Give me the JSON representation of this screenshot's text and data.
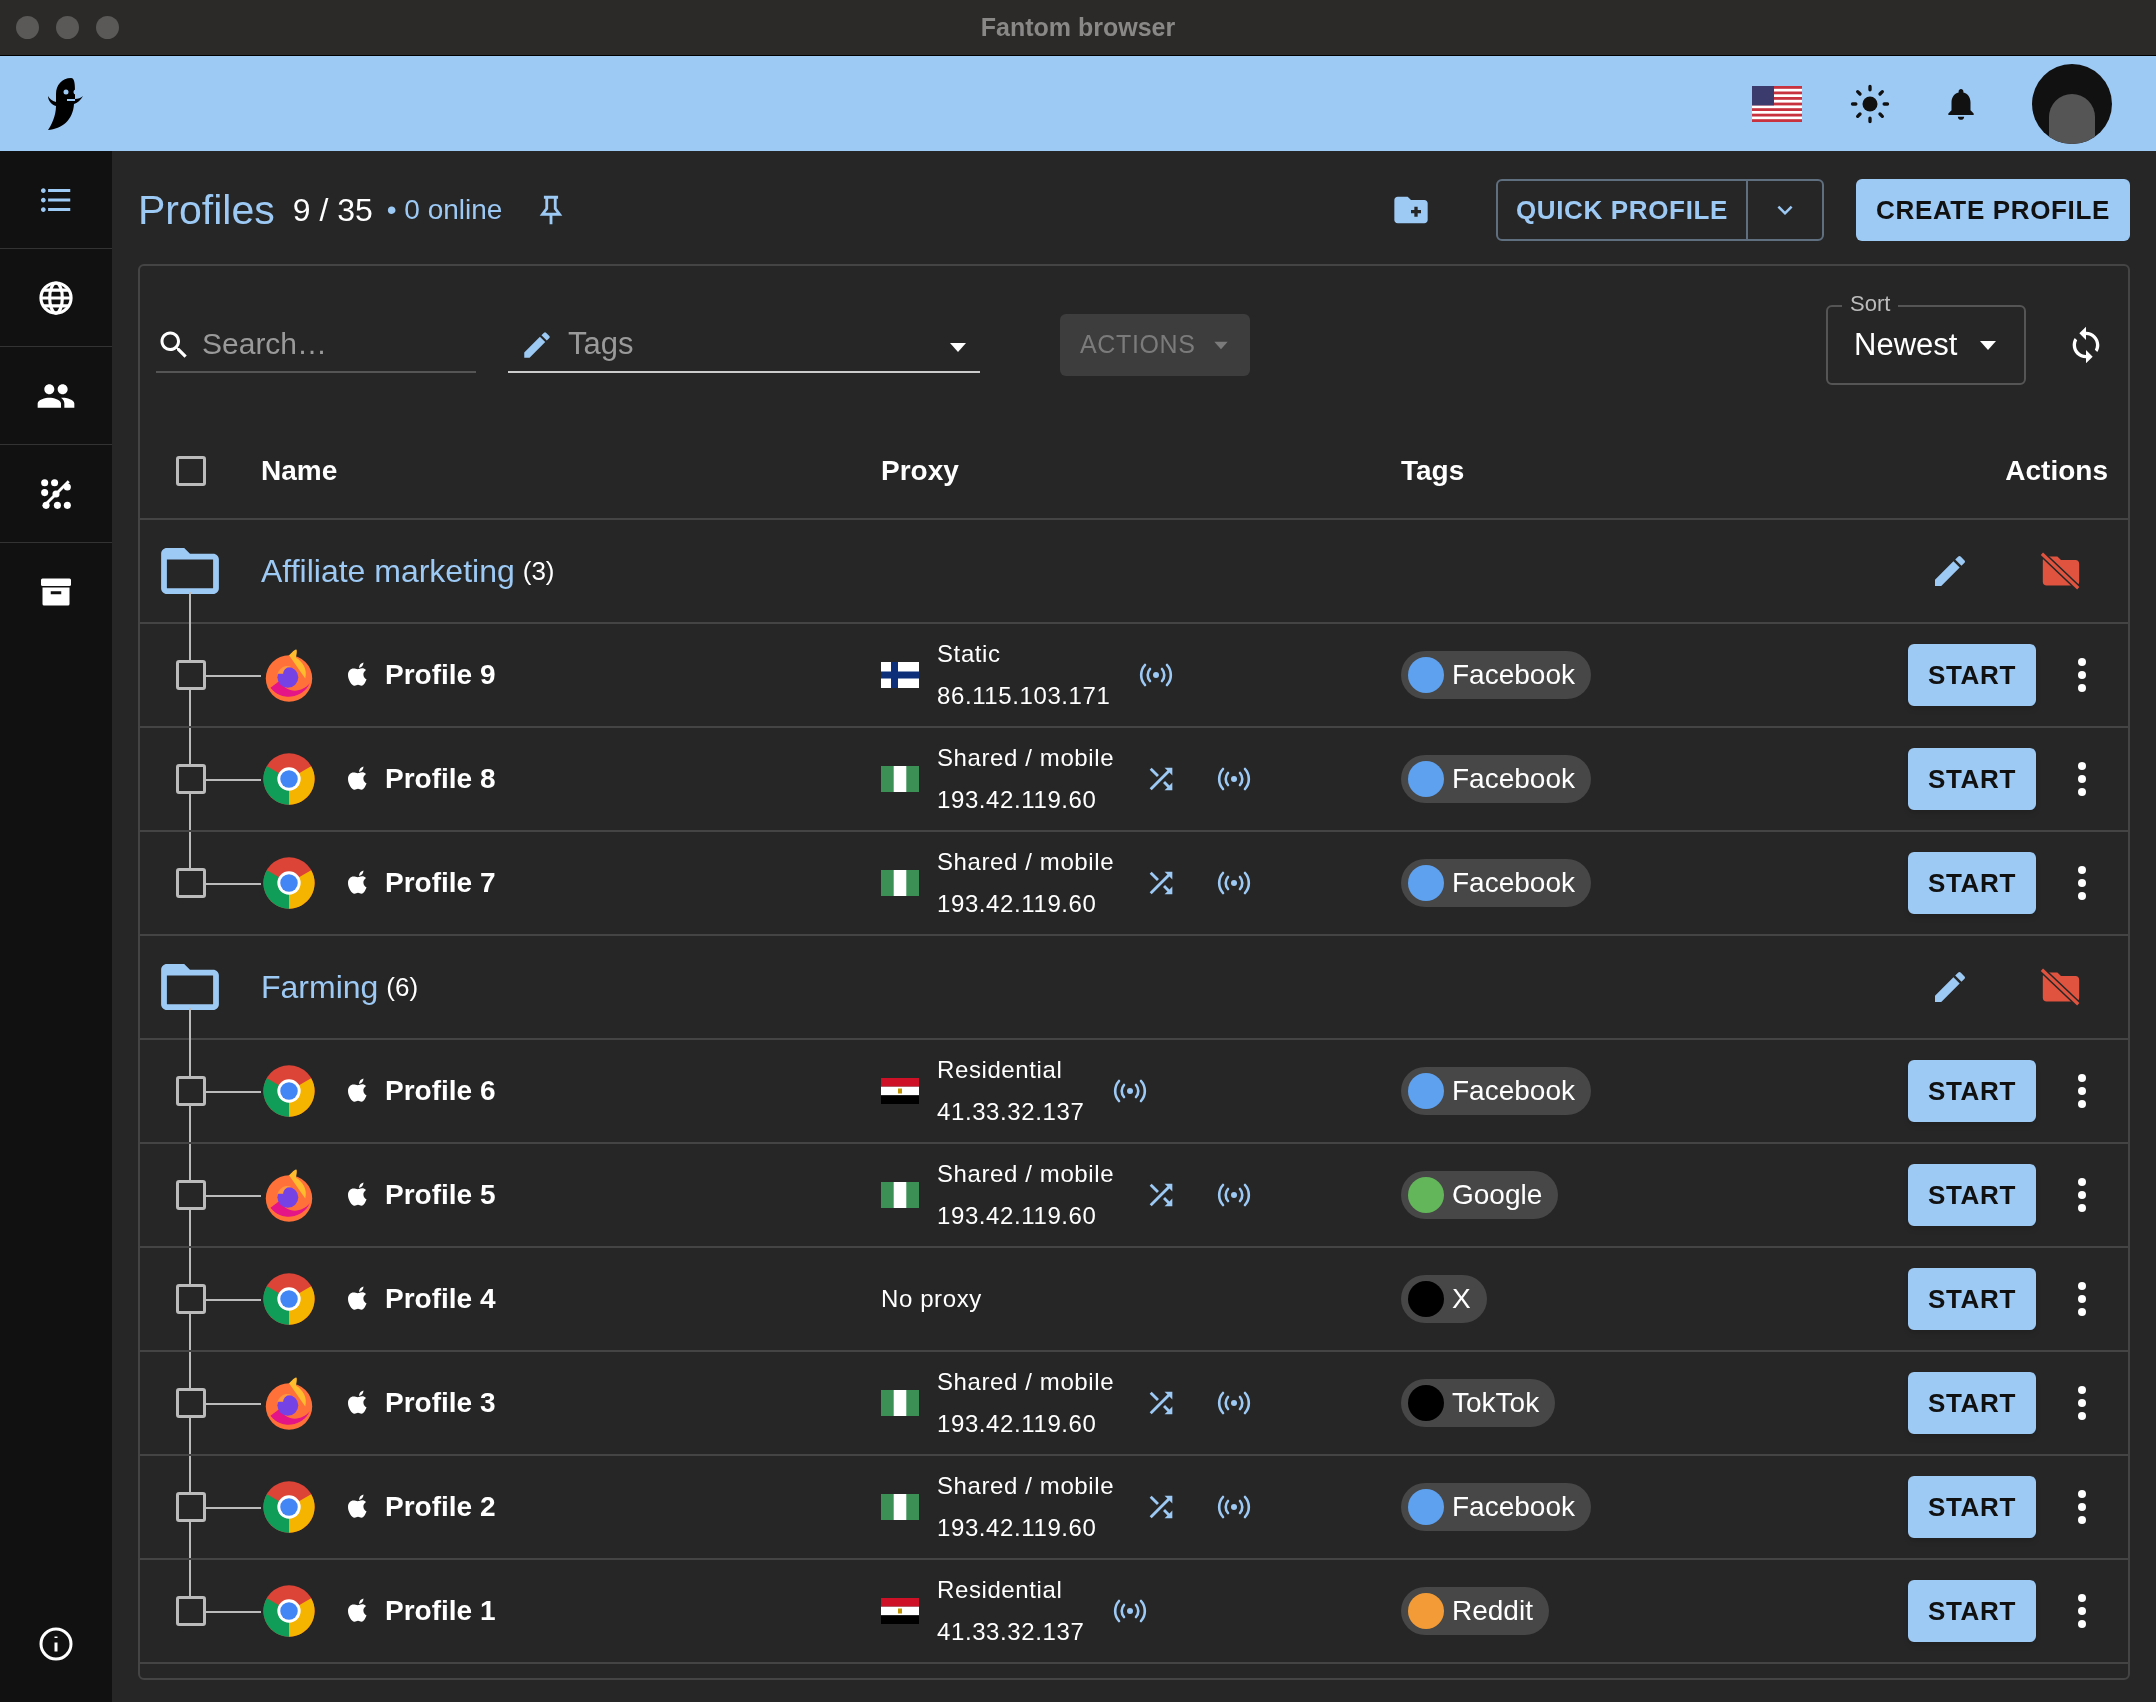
{
  "window": {
    "title": "Fantom browser"
  },
  "header": {
    "title": "Profiles",
    "count": "9 / 35",
    "online": "• 0 online",
    "quick_profile": "QUICK PROFILE",
    "create_profile": "CREATE PROFILE"
  },
  "filters": {
    "search_placeholder": "Search…",
    "tags_placeholder": "Tags",
    "actions": "ACTIONS",
    "sort_label": "Sort",
    "sort_value": "Newest"
  },
  "table": {
    "select_all_checked": false,
    "columns": [
      "Name",
      "Proxy",
      "Tags",
      "Actions"
    ]
  },
  "groups": [
    {
      "name": "Affiliate marketing",
      "count": "(3)",
      "profiles": [
        {
          "name": "Profile 9",
          "checked": false,
          "kind": "firefox",
          "proxy": {
            "kind": "finland",
            "type": "Static",
            "ip": "86.115.103.171",
            "rotating": false
          },
          "tag": {
            "label": "Facebook",
            "color": "#5ea1ef"
          },
          "start": "START"
        },
        {
          "name": "Profile 8",
          "checked": false,
          "kind": "chrome",
          "proxy": {
            "kind": "nigeria",
            "type": "Shared / mobile",
            "ip": "193.42.119.60",
            "rotating": true
          },
          "tag": {
            "label": "Facebook",
            "color": "#5ea1ef"
          },
          "start": "START"
        },
        {
          "name": "Profile 7",
          "checked": false,
          "kind": "chrome",
          "proxy": {
            "kind": "nigeria",
            "type": "Shared / mobile",
            "ip": "193.42.119.60",
            "rotating": true
          },
          "tag": {
            "label": "Facebook",
            "color": "#5ea1ef"
          },
          "start": "START"
        }
      ]
    },
    {
      "name": "Farming",
      "count": "(6)",
      "profiles": [
        {
          "name": "Profile 6",
          "checked": false,
          "kind": "chrome",
          "proxy": {
            "kind": "egypt",
            "type": "Residential",
            "ip": "41.33.32.137",
            "rotating": false
          },
          "tag": {
            "label": "Facebook",
            "color": "#5ea1ef"
          },
          "start": "START"
        },
        {
          "name": "Profile 5",
          "checked": false,
          "kind": "firefox",
          "proxy": {
            "kind": "nigeria",
            "type": "Shared / mobile",
            "ip": "193.42.119.60",
            "rotating": true
          },
          "tag": {
            "label": "Google",
            "color": "#63b75a"
          },
          "start": "START"
        },
        {
          "name": "Profile 4",
          "checked": false,
          "kind": "chrome",
          "proxy": {
            "kind": "none",
            "type": "No proxy"
          },
          "tag": {
            "label": "X",
            "color": "#000000"
          },
          "start": "START"
        },
        {
          "name": "Profile 3",
          "checked": false,
          "kind": "firefox",
          "proxy": {
            "kind": "nigeria",
            "type": "Shared / mobile",
            "ip": "193.42.119.60",
            "rotating": true
          },
          "tag": {
            "label": "TokTok",
            "color": "#000000"
          },
          "start": "START"
        },
        {
          "name": "Profile 2",
          "checked": false,
          "kind": "chrome",
          "proxy": {
            "kind": "nigeria",
            "type": "Shared / mobile",
            "ip": "193.42.119.60",
            "rotating": true
          },
          "tag": {
            "label": "Facebook",
            "color": "#5ea1ef"
          },
          "start": "START"
        },
        {
          "name": "Profile 1",
          "checked": false,
          "kind": "chrome",
          "proxy": {
            "kind": "egypt",
            "type": "Residential",
            "ip": "41.33.32.137",
            "rotating": false
          },
          "tag": {
            "label": "Reddit",
            "color": "#f39c37"
          },
          "start": "START"
        }
      ]
    }
  ]
}
